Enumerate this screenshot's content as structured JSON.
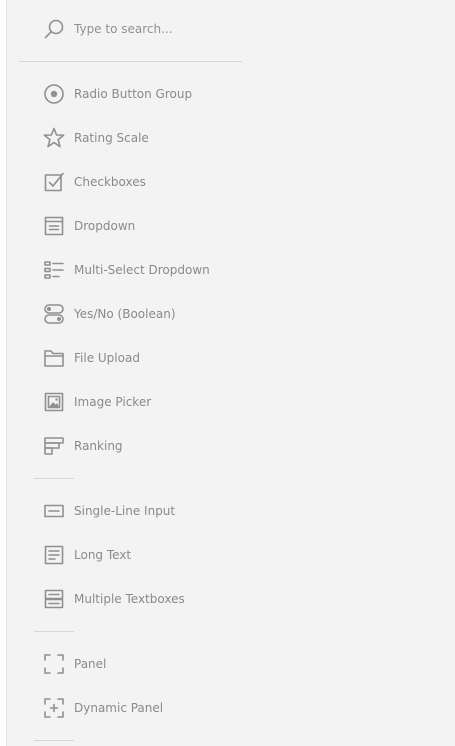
{
  "search": {
    "placeholder": "Type to search..."
  },
  "toolbox": {
    "groups": [
      {
        "items": [
          {
            "label": "Radio Button Group",
            "icon": "radio-button-group-icon"
          },
          {
            "label": "Rating Scale",
            "icon": "star-icon"
          },
          {
            "label": "Checkboxes",
            "icon": "checkbox-icon"
          },
          {
            "label": "Dropdown",
            "icon": "dropdown-icon"
          },
          {
            "label": "Multi-Select Dropdown",
            "icon": "multi-select-dropdown-icon"
          },
          {
            "label": "Yes/No (Boolean)",
            "icon": "boolean-toggle-icon"
          },
          {
            "label": "File Upload",
            "icon": "folder-icon"
          },
          {
            "label": "Image Picker",
            "icon": "image-picker-icon"
          },
          {
            "label": "Ranking",
            "icon": "ranking-icon"
          }
        ]
      },
      {
        "items": [
          {
            "label": "Single-Line Input",
            "icon": "single-line-input-icon"
          },
          {
            "label": "Long Text",
            "icon": "long-text-icon"
          },
          {
            "label": "Multiple Textboxes",
            "icon": "multiple-textboxes-icon"
          }
        ]
      },
      {
        "items": [
          {
            "label": "Panel",
            "icon": "panel-icon"
          },
          {
            "label": "Dynamic Panel",
            "icon": "dynamic-panel-icon"
          }
        ]
      }
    ]
  },
  "colors": {
    "background": "#f3f3f3",
    "text": "#8a8a8a",
    "icon": "#909090",
    "divider": "#d6d6d6"
  }
}
